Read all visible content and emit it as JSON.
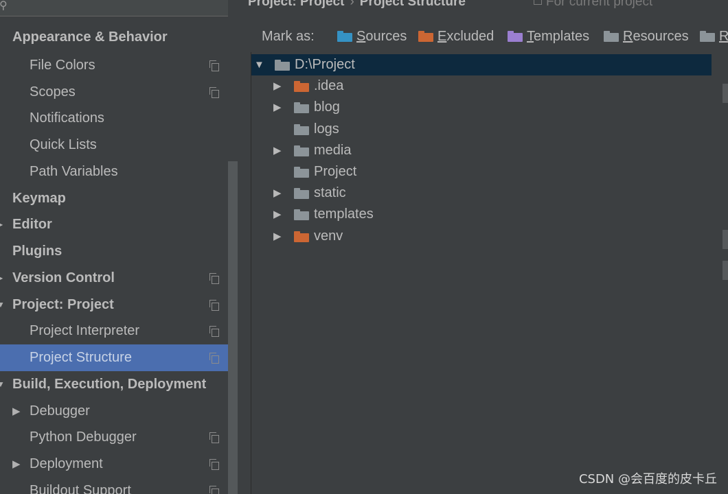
{
  "sidebar": {
    "items": [
      {
        "label": "Appearance & Behavior",
        "level": 0,
        "bold": true,
        "arrow": "",
        "copy": false
      },
      {
        "label": "File Colors",
        "level": 1,
        "bold": false,
        "arrow": "",
        "copy": true
      },
      {
        "label": "Scopes",
        "level": 1,
        "bold": false,
        "arrow": "",
        "copy": true
      },
      {
        "label": "Notifications",
        "level": 1,
        "bold": false,
        "arrow": "",
        "copy": false
      },
      {
        "label": "Quick Lists",
        "level": 1,
        "bold": false,
        "arrow": "",
        "copy": false
      },
      {
        "label": "Path Variables",
        "level": 1,
        "bold": false,
        "arrow": "",
        "copy": false
      },
      {
        "label": "Keymap",
        "level": 0,
        "bold": true,
        "arrow": "",
        "copy": false
      },
      {
        "label": "Editor",
        "level": 0,
        "bold": true,
        "arrow": "collapsed",
        "copy": false
      },
      {
        "label": "Plugins",
        "level": 0,
        "bold": true,
        "arrow": "",
        "copy": false
      },
      {
        "label": "Version Control",
        "level": 0,
        "bold": true,
        "arrow": "collapsed",
        "copy": true
      },
      {
        "label": "Project: Project",
        "level": 0,
        "bold": true,
        "arrow": "expanded",
        "copy": true
      },
      {
        "label": "Project Interpreter",
        "level": 1,
        "bold": false,
        "arrow": "",
        "copy": true
      },
      {
        "label": "Project Structure",
        "level": 1,
        "bold": false,
        "arrow": "",
        "copy": true,
        "selected": true
      },
      {
        "label": "Build, Execution, Deployment",
        "level": 0,
        "bold": true,
        "arrow": "expanded",
        "copy": false
      },
      {
        "label": "Debugger",
        "level": 1,
        "bold": false,
        "arrow": "collapsed",
        "copy": false
      },
      {
        "label": "Python Debugger",
        "level": 1,
        "bold": false,
        "arrow": "",
        "copy": true
      },
      {
        "label": "Deployment",
        "level": 1,
        "bold": false,
        "arrow": "collapsed",
        "copy": true
      },
      {
        "label": "Buildout Support",
        "level": 1,
        "bold": false,
        "arrow": "",
        "copy": true
      }
    ]
  },
  "header": {
    "crumb_parent": "Project: Project",
    "crumb_sep": "›",
    "crumb_current": "Project Structure",
    "scope_note": "For current project"
  },
  "markbar": {
    "label": "Mark as:",
    "buttons": [
      {
        "mnemonic": "S",
        "rest": "ources",
        "color": "#3592c4"
      },
      {
        "mnemonic": "E",
        "rest": "xcluded",
        "color": "#cc6633"
      },
      {
        "mnemonic": "T",
        "rest": "emplates",
        "color": "#9b7fd1"
      },
      {
        "mnemonic": "R",
        "rest": "esources",
        "color": "#8c9499"
      },
      {
        "mnemonic": "R",
        "rest": "",
        "color": "#8c9499"
      }
    ]
  },
  "tree": {
    "rows": [
      {
        "name": "D:\\Project",
        "depth": 0,
        "arrow": "expanded",
        "color": "#8c9499",
        "selected": true
      },
      {
        "name": ".idea",
        "depth": 1,
        "arrow": "collapsed",
        "color": "#cc6633"
      },
      {
        "name": "blog",
        "depth": 1,
        "arrow": "collapsed",
        "color": "#8c9499"
      },
      {
        "name": "logs",
        "depth": 1,
        "arrow": "",
        "color": "#8c9499"
      },
      {
        "name": "media",
        "depth": 1,
        "arrow": "collapsed",
        "color": "#8c9499"
      },
      {
        "name": "Project",
        "depth": 1,
        "arrow": "",
        "color": "#8c9499"
      },
      {
        "name": "static",
        "depth": 1,
        "arrow": "collapsed",
        "color": "#8c9499"
      },
      {
        "name": "templates",
        "depth": 1,
        "arrow": "collapsed",
        "color": "#8c9499"
      },
      {
        "name": "venv",
        "depth": 1,
        "arrow": "collapsed",
        "color": "#cc6633"
      }
    ]
  },
  "watermark": "CSDN @会百度的皮卡丘",
  "colors": {
    "background": "#3c3f41",
    "selection": "#4b6eaf",
    "tree_selection": "#0d293e",
    "excluded": "#cc6633",
    "sources": "#3592c4",
    "templates": "#9b7fd1"
  }
}
